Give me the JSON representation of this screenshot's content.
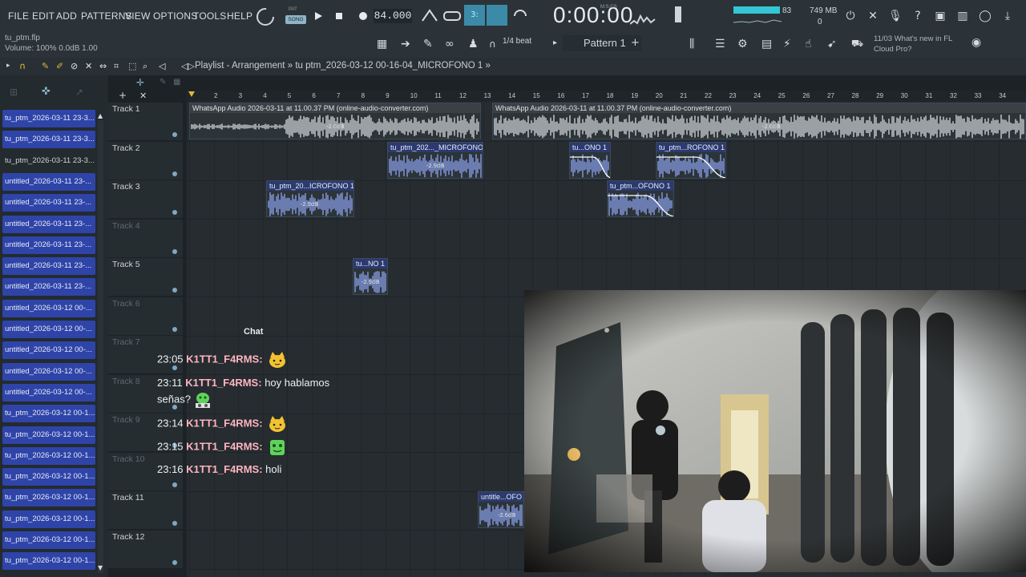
{
  "menu": {
    "items": [
      "FILE",
      "EDIT",
      "ADD",
      "PATTERNS",
      "VIEW",
      "OPTIONS",
      "TOOLS",
      "HELP"
    ]
  },
  "hint": {
    "project": "tu_ptm.flp",
    "volume": "Volume: 100%  0.0dB  1.00"
  },
  "transport": {
    "pat_label": "PAT",
    "song_label": "SONG",
    "tempo": "84.000",
    "time": "0:00:00",
    "time_unit": "M:S:CS",
    "cpu": "83",
    "memory": "749 MB",
    "memory_sub": "0"
  },
  "toolbar": {
    "beat": "1/4 beat",
    "pattern": "Pattern 1",
    "news_date": "11/03",
    "news_title": "What's new in FL",
    "news_sub": "Cloud Pro?"
  },
  "playlist": {
    "title": "Playlist - Arrangement",
    "breadcrumb_sep": "»",
    "project": "tu",
    "clip_path": "ptm_2026-03-12 00-16-04_MICROFONO 1"
  },
  "browser": {
    "items": [
      {
        "label": "tu_ptm_2026-03-11 23-3...",
        "style": "blue"
      },
      {
        "label": "tu_ptm_2026-03-11 23-3...",
        "style": "blue"
      },
      {
        "label": "tu_ptm_2026-03-11 23-3...",
        "style": "plain"
      },
      {
        "label": "untitled_2026-03-11 23-...",
        "style": "blue"
      },
      {
        "label": "untitled_2026-03-11 23-...",
        "style": "blue"
      },
      {
        "label": "untitled_2026-03-11 23-...",
        "style": "blue"
      },
      {
        "label": "untitled_2026-03-11 23-...",
        "style": "blue"
      },
      {
        "label": "untitled_2026-03-11 23-...",
        "style": "blue"
      },
      {
        "label": "untitled_2026-03-11 23-...",
        "style": "blue"
      },
      {
        "label": "untitled_2026-03-12 00-...",
        "style": "blue"
      },
      {
        "label": "untitled_2026-03-12 00-...",
        "style": "blue"
      },
      {
        "label": "untitled_2026-03-12 00-...",
        "style": "blue"
      },
      {
        "label": "untitled_2026-03-12 00-...",
        "style": "blue"
      },
      {
        "label": "untitled_2026-03-12 00-...",
        "style": "blue"
      },
      {
        "label": "tu_ptm_2026-03-12 00-1...",
        "style": "blue"
      },
      {
        "label": "tu_ptm_2026-03-12 00-1...",
        "style": "blue"
      },
      {
        "label": "tu_ptm_2026-03-12 00-1...",
        "style": "blue"
      },
      {
        "label": "tu_ptm_2026-03-12 00-1...",
        "style": "blue"
      },
      {
        "label": "tu_ptm_2026-03-12 00-1...",
        "style": "blue"
      },
      {
        "label": "tu_ptm_2026-03-12 00-1...",
        "style": "blue"
      },
      {
        "label": "tu_ptm_2026-03-12 00-1...",
        "style": "blue"
      },
      {
        "label": "tu_ptm_2026-03-12 00-1...",
        "style": "blue"
      }
    ]
  },
  "tracks": [
    {
      "name": "Track 1",
      "dim": false
    },
    {
      "name": "Track 2",
      "dim": false
    },
    {
      "name": "Track 3",
      "dim": false
    },
    {
      "name": "Track 4",
      "dim": true
    },
    {
      "name": "Track 5",
      "dim": false
    },
    {
      "name": "Track 6",
      "dim": true
    },
    {
      "name": "Track 7",
      "dim": true
    },
    {
      "name": "Track 8",
      "dim": true
    },
    {
      "name": "Track 9",
      "dim": true
    },
    {
      "name": "Track 10",
      "dim": true
    },
    {
      "name": "Track 11",
      "dim": false
    },
    {
      "name": "Track 12",
      "dim": false
    }
  ],
  "ruler": [
    "2",
    "3",
    "4",
    "5",
    "6",
    "7",
    "8",
    "9",
    "10",
    "11",
    "12",
    "13",
    "14",
    "15",
    "16",
    "17",
    "18",
    "19",
    "20",
    "21",
    "22",
    "23",
    "24",
    "25",
    "26",
    "27",
    "28",
    "29",
    "30",
    "31",
    "32",
    "33",
    "34"
  ],
  "clips": [
    {
      "label": "WhatsApp Audio 2026-03-11 at 11.00.37 PM (online-audio-converter.com)",
      "gain": "-2.0dB",
      "track": 0,
      "kind": "gray"
    },
    {
      "label": "WhatsApp Audio 2026-03-11 at 11.00.37 PM (online-audio-converter.com)",
      "gain": "-2.0dB",
      "track": 0,
      "kind": "gray"
    },
    {
      "label": "tu_ptm_202..._MICROFONO 1",
      "gain": "-2.9dB",
      "track": 1,
      "kind": "blue"
    },
    {
      "label": "tu...ONO 1",
      "gain": "",
      "track": 1,
      "kind": "blue"
    },
    {
      "label": "tu_ptm...ROFONO 1",
      "gain": "",
      "track": 1,
      "kind": "blue"
    },
    {
      "label": "tu_ptm_20...ICROFONO 1",
      "gain": "-2.9dB",
      "track": 2,
      "kind": "blue"
    },
    {
      "label": "tu_ptm...OFONO 1",
      "gain": "",
      "track": 2,
      "kind": "blue"
    },
    {
      "label": "tu...NO 1",
      "gain": "-2.9dB",
      "track": 4,
      "kind": "blue"
    },
    {
      "label": "untitle...OFO",
      "gain": "-2.6dB",
      "track": 10,
      "kind": "blue"
    }
  ],
  "chat": {
    "title": "Chat",
    "messages": [
      {
        "time": "23:05",
        "user": "K1TT1_F4RMS:",
        "text": "",
        "emote": "cat-emote"
      },
      {
        "time": "23:11",
        "user": "K1TT1_F4RMS:",
        "text": "hoy hablamos",
        "text2": "señas?",
        "emote": "frog-dj-emote"
      },
      {
        "time": "23:14",
        "user": "K1TT1_F4RMS:",
        "text": "",
        "emote": "cat-emote"
      },
      {
        "time": "23:15",
        "user": "K1TT1_F4RMS:",
        "text": "",
        "emote": "frog-emote"
      },
      {
        "time": "23:16",
        "user": "K1TT1_F4RMS:",
        "text": "holi",
        "emote": ""
      }
    ]
  },
  "colors": {
    "accent_blue": "#2f44a8",
    "wave_blue": "#8ea3f0",
    "meter_cyan": "#35c6d6",
    "chat_user": "#ffb4c0"
  }
}
